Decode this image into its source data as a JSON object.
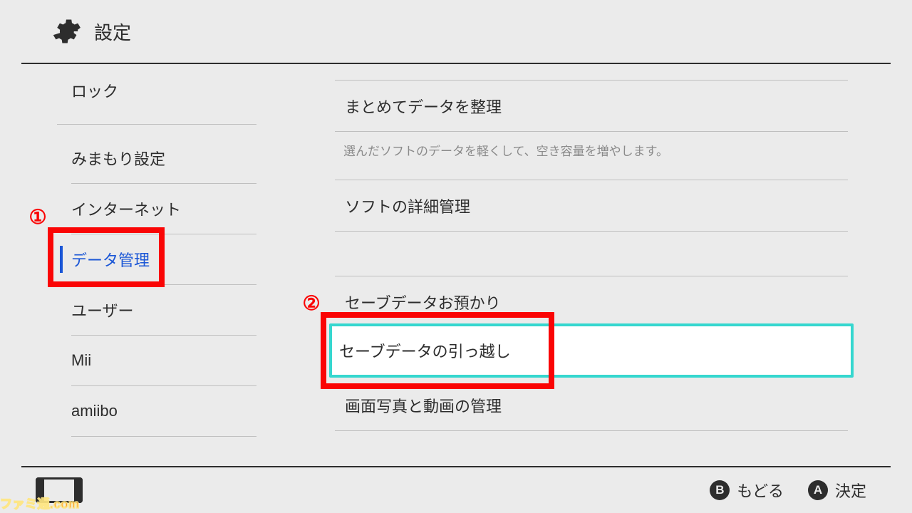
{
  "header": {
    "title": "設定"
  },
  "sidebar": {
    "items": [
      {
        "id": "lock",
        "label": "ロック"
      },
      {
        "id": "parental",
        "label": "みまもり設定"
      },
      {
        "id": "internet",
        "label": "インターネット"
      },
      {
        "id": "data",
        "label": "データ管理",
        "selected": true
      },
      {
        "id": "user",
        "label": "ユーザー"
      },
      {
        "id": "mii",
        "label": "Mii"
      },
      {
        "id": "amiibo",
        "label": "amiibo"
      }
    ]
  },
  "panel": {
    "rows": [
      {
        "id": "organize",
        "label": "まとめてデータを整理"
      },
      {
        "id": "detail",
        "label": "ソフトの詳細管理"
      },
      {
        "id": "cloud",
        "label": "セーブデータお預かり"
      },
      {
        "id": "transfer",
        "label": "セーブデータの引っ越し",
        "highlight": true
      },
      {
        "id": "album",
        "label": "画面写真と動画の管理"
      }
    ],
    "organize_helper": "選んだソフトのデータを軽くして、空き容量を増やします。"
  },
  "footer": {
    "b_label": "もどる",
    "a_label": "決定"
  },
  "annotations": {
    "one": "①",
    "two": "②"
  },
  "watermark": "ファミ通.com"
}
